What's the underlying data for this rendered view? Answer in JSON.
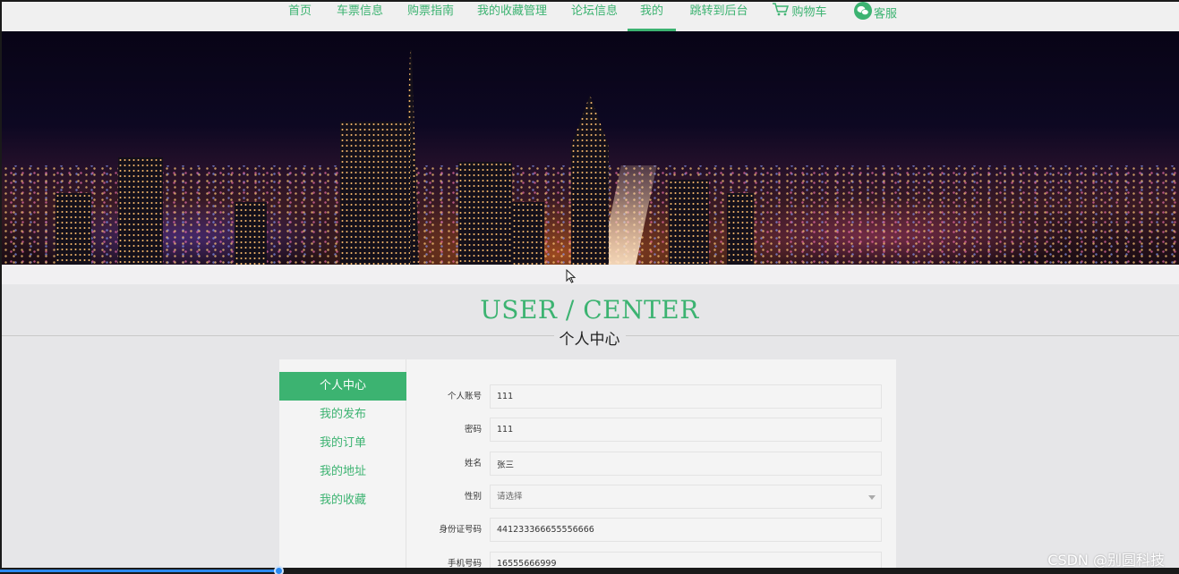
{
  "nav": {
    "items": [
      {
        "label": "首页"
      },
      {
        "label": "车票信息"
      },
      {
        "label": "购票指南"
      },
      {
        "label": "我的收藏管理"
      },
      {
        "label": "论坛信息"
      },
      {
        "label": "我的",
        "active": true
      },
      {
        "label": "跳转到后台"
      },
      {
        "label": "购物车",
        "icon": "cart-icon"
      },
      {
        "label": "客服",
        "icon": "wechat-icon"
      }
    ]
  },
  "banner": {
    "description_icon": "city-night-banner"
  },
  "heading": {
    "english": "USER / CENTER",
    "chinese": "个人中心"
  },
  "sidebar": {
    "items": [
      {
        "label": "个人中心",
        "active": true
      },
      {
        "label": "我的发布"
      },
      {
        "label": "我的订单"
      },
      {
        "label": "我的地址"
      },
      {
        "label": "我的收藏"
      }
    ]
  },
  "form": {
    "account": {
      "label": "个人账号",
      "value": "111"
    },
    "password": {
      "label": "密码",
      "value": "111"
    },
    "name": {
      "label": "姓名",
      "value": "张三"
    },
    "gender": {
      "label": "性别",
      "placeholder": "请选择"
    },
    "id_number": {
      "label": "身份证号码",
      "value": "441233366655556666"
    },
    "phone": {
      "label": "手机号码",
      "value": "16555666999"
    }
  },
  "video": {
    "progress": 0.236
  },
  "watermark": "CSDN @别圆科技",
  "colors": {
    "accent": "#3cb371",
    "progress": "#2b8af0"
  }
}
